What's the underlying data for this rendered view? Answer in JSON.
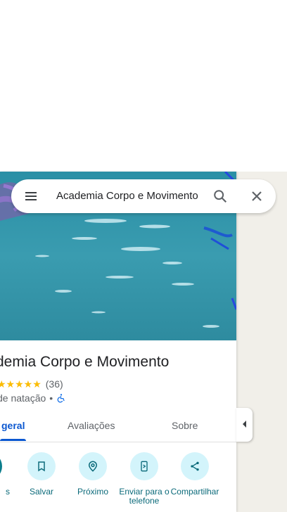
{
  "search": {
    "query": "Academia Corpo e Movimento",
    "icons": {
      "menu": "menu-icon",
      "search": "search-icon",
      "close": "close-icon"
    }
  },
  "place": {
    "title": "demia Corpo e Movimento",
    "stars_display": "★★★★★",
    "rating_value": 5,
    "review_count": "(36)",
    "category": "de natação",
    "separator": "•",
    "accessibility_icon": "wheelchair-icon"
  },
  "tabs": [
    {
      "label": "geral",
      "active": true
    },
    {
      "label": "Avaliações",
      "active": false
    },
    {
      "label": "Sobre",
      "active": false
    }
  ],
  "actions": [
    {
      "label": "s",
      "icon": "directions-icon"
    },
    {
      "label": "Salvar",
      "icon": "bookmark-icon"
    },
    {
      "label": "Próximo",
      "icon": "nearby-icon"
    },
    {
      "label": "Enviar para o telefone",
      "icon": "send-to-phone-icon"
    },
    {
      "label": "Compartilhar",
      "icon": "share-icon"
    }
  ],
  "colors": {
    "accent": "#0b57d0",
    "action_circle": "#d3f4fb",
    "action_text": "#0b6a7a",
    "star": "#fbbc04",
    "water": "#2d8ea2"
  },
  "panel": {
    "collapse_icon": "collapse-panel-icon"
  }
}
